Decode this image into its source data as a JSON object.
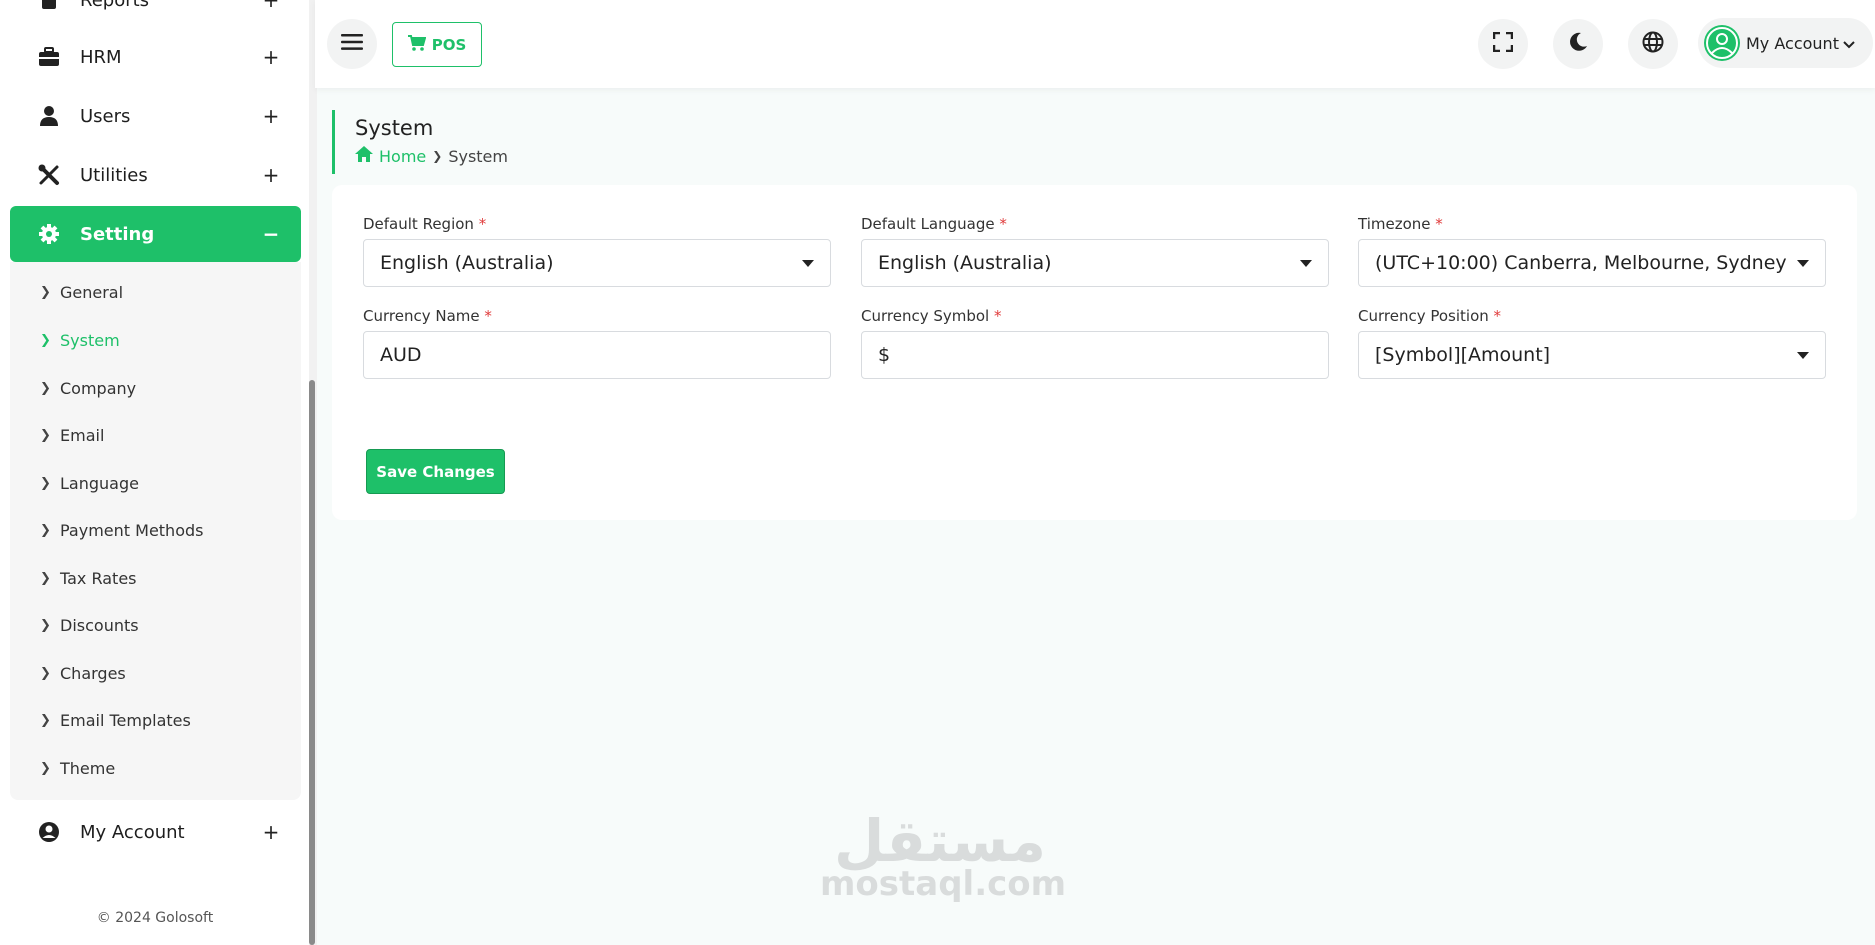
{
  "sidebar": {
    "items": [
      {
        "label": "Reports",
        "toggle": "+"
      },
      {
        "label": "HRM",
        "toggle": "+"
      },
      {
        "label": "Users",
        "toggle": "+"
      },
      {
        "label": "Utilities",
        "toggle": "+"
      },
      {
        "label": "Setting",
        "toggle": "−"
      },
      {
        "label": "My Account",
        "toggle": "+"
      }
    ],
    "submenu": [
      "General",
      "System",
      "Company",
      "Email",
      "Language",
      "Payment Methods",
      "Tax Rates",
      "Discounts",
      "Charges",
      "Email Templates",
      "Theme"
    ],
    "copyright": "© 2024 Golosoft"
  },
  "header": {
    "pos_label": "POS",
    "account_label": "My Account"
  },
  "page": {
    "title": "System",
    "breadcrumb_home": "Home",
    "breadcrumb_current": "System"
  },
  "form": {
    "default_region": {
      "label": "Default Region",
      "value": "English (Australia)"
    },
    "default_language": {
      "label": "Default Language",
      "value": "English (Australia)"
    },
    "timezone": {
      "label": "Timezone",
      "value": "(UTC+10:00) Canberra, Melbourne, Sydney"
    },
    "currency_name": {
      "label": "Currency Name",
      "value": "AUD"
    },
    "currency_symbol": {
      "label": "Currency Symbol",
      "value": "$"
    },
    "currency_position": {
      "label": "Currency Position",
      "value": "[Symbol][Amount]"
    },
    "required_mark": "*",
    "save_label": "Save Changes"
  },
  "watermark": {
    "arabic": "مستقل",
    "latin": "mostaql.com"
  },
  "colors": {
    "accent": "#1ec069",
    "required": "#e03c3c"
  }
}
